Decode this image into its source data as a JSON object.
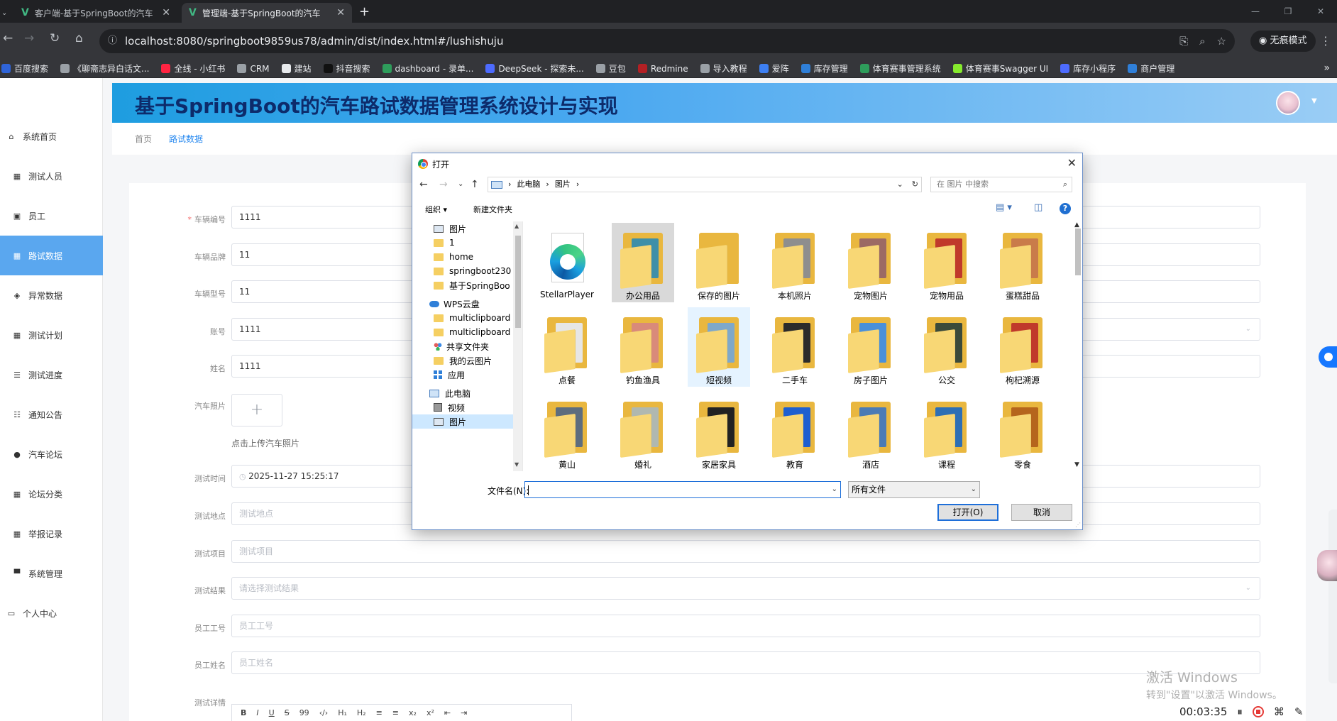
{
  "browser": {
    "tabs": [
      {
        "title": "客户端-基于SpringBoot的汽车"
      },
      {
        "title": "管理端-基于SpringBoot的汽车"
      }
    ],
    "url": "localhost:8080/springboot9859us78/admin/dist/index.html#/lushishuju",
    "incognito_label": "无痕模式",
    "bookmarks": [
      {
        "label": "百度搜索",
        "color": "#2f64d8"
      },
      {
        "label": "《聊斋志异白话文...",
        "color": "#9aa0a6"
      },
      {
        "label": "全线 - 小红书",
        "color": "#ff2442"
      },
      {
        "label": "CRM",
        "color": "#9aa0a6"
      },
      {
        "label": "建站",
        "color": "#e8eaed"
      },
      {
        "label": "抖音搜索",
        "color": "#111111"
      },
      {
        "label": "dashboard - 录单...",
        "color": "#2e9d5b"
      },
      {
        "label": "DeepSeek - 探索未...",
        "color": "#4d6bfe"
      },
      {
        "label": "豆包",
        "color": "#9aa0a6"
      },
      {
        "label": "Redmine",
        "color": "#b32024"
      },
      {
        "label": "导入教程",
        "color": "#9aa0a6"
      },
      {
        "label": "爱阵",
        "color": "#3d7ff2"
      },
      {
        "label": "库存管理",
        "color": "#2f7fd8"
      },
      {
        "label": "体育赛事管理系统",
        "color": "#2e9d5b"
      },
      {
        "label": "体育赛事Swagger UI",
        "color": "#85ea2d"
      },
      {
        "label": "库存小程序",
        "color": "#4d6bfe"
      },
      {
        "label": "商户管理",
        "color": "#2f7fd8"
      }
    ]
  },
  "app": {
    "title": "基于SpringBoot的汽车路试数据管理系统设计与实现",
    "breadcrumb": {
      "home": "首页",
      "current": "路试数据"
    },
    "menu": [
      {
        "label": "系统首页",
        "icon": "home-icon"
      },
      {
        "label": "测试人员",
        "icon": "grid-icon"
      },
      {
        "label": "员工",
        "icon": "user-card-icon"
      },
      {
        "label": "路试数据",
        "icon": "grid-icon"
      },
      {
        "label": "异常数据",
        "icon": "warn-icon"
      },
      {
        "label": "测试计划",
        "icon": "grid-icon"
      },
      {
        "label": "测试进度",
        "icon": "list-icon"
      },
      {
        "label": "通知公告",
        "icon": "sliders-icon"
      },
      {
        "label": "汽车论坛",
        "icon": "person-icon"
      },
      {
        "label": "论坛分类",
        "icon": "grid-icon"
      },
      {
        "label": "举报记录",
        "icon": "grid-icon"
      },
      {
        "label": "系统管理",
        "icon": "monitor-icon"
      },
      {
        "label": "个人中心",
        "icon": "card-icon"
      }
    ],
    "form": {
      "vehicle_no": {
        "label": "车辆编号",
        "value": "1111"
      },
      "brand": {
        "label": "车辆品牌",
        "value": "11"
      },
      "model": {
        "label": "车辆型号",
        "value": "11"
      },
      "account": {
        "label": "账号",
        "value": "1111"
      },
      "name": {
        "label": "姓名",
        "value": "1111"
      },
      "photo": {
        "label": "汽车照片",
        "hint": "点击上传汽车照片"
      },
      "test_time": {
        "label": "测试时间",
        "value": "2025-11-27 15:25:17"
      },
      "test_place": {
        "label": "测试地点",
        "placeholder": "测试地点"
      },
      "test_item": {
        "label": "测试项目",
        "placeholder": "测试项目"
      },
      "test_result": {
        "label": "测试结果",
        "placeholder": "请选择测试结果"
      },
      "emp_no": {
        "label": "员工工号",
        "placeholder": "员工工号"
      },
      "emp_name": {
        "label": "员工姓名",
        "placeholder": "员工姓名"
      },
      "detail": {
        "label": "测试详情"
      }
    },
    "editor_tools": [
      "B",
      "I",
      "U",
      "S",
      "99",
      "‹/›",
      "H₁",
      "H₂",
      "≡",
      "≡",
      "x₂",
      "x²",
      "⇤",
      "⇥"
    ]
  },
  "dialog": {
    "title": "打开",
    "path": [
      "此电脑",
      "图片"
    ],
    "search_placeholder": "在 图片 中搜索",
    "organize": "组织",
    "new_folder": "新建文件夹",
    "nav": [
      {
        "label": "图片",
        "icon": "pictures-icon"
      },
      {
        "label": "1",
        "icon": "folder-icon"
      },
      {
        "label": "home",
        "icon": "folder-icon"
      },
      {
        "label": "springboot230",
        "icon": "folder-icon"
      },
      {
        "label": "基于SpringBoo",
        "icon": "folder-icon"
      },
      {
        "label": "WPS云盘",
        "icon": "cloud-icon"
      },
      {
        "label": "multiclipboard",
        "icon": "folder-icon"
      },
      {
        "label": "multiclipboard",
        "icon": "folder-icon"
      },
      {
        "label": "共享文件夹",
        "icon": "shared-icon"
      },
      {
        "label": "我的云图片",
        "icon": "folder-icon"
      },
      {
        "label": "应用",
        "icon": "apps-icon"
      },
      {
        "label": "此电脑",
        "icon": "pc-icon"
      },
      {
        "label": "视频",
        "icon": "video-icon"
      },
      {
        "label": "图片",
        "icon": "pictures-icon"
      }
    ],
    "files": [
      {
        "name": "StellarPlayer",
        "kind": "app"
      },
      {
        "name": "办公用品",
        "kind": "folder",
        "photo": "#3f8fa8"
      },
      {
        "name": "保存的图片",
        "kind": "folder",
        "photo": ""
      },
      {
        "name": "本机照片",
        "kind": "folder",
        "photo": "#8e8e8e"
      },
      {
        "name": "宠物图片",
        "kind": "folder",
        "photo": "#9c6a64"
      },
      {
        "name": "宠物用品",
        "kind": "folder",
        "photo": "#c0392b"
      },
      {
        "name": "蛋糕甜品",
        "kind": "folder",
        "photo": "#c97b4a"
      },
      {
        "name": "点餐",
        "kind": "folder",
        "photo": "#e6e6e6"
      },
      {
        "name": "钓鱼渔具",
        "kind": "folder",
        "photo": "#d98a7a"
      },
      {
        "name": "短视频",
        "kind": "folder",
        "photo": "#7fa8c9"
      },
      {
        "name": "二手车",
        "kind": "folder",
        "photo": "#2b2b2b"
      },
      {
        "name": "房子图片",
        "kind": "folder",
        "photo": "#4a90d9"
      },
      {
        "name": "公交",
        "kind": "folder",
        "photo": "#3b4a3a"
      },
      {
        "name": "枸杞溯源",
        "kind": "folder",
        "photo": "#c0392b"
      },
      {
        "name": "黄山",
        "kind": "folder",
        "photo": "#5d6d7e"
      },
      {
        "name": "婚礼",
        "kind": "folder",
        "photo": "#b0b8b0"
      },
      {
        "name": "家居家具",
        "kind": "folder",
        "photo": "#222222"
      },
      {
        "name": "教育",
        "kind": "folder",
        "photo": "#1e5fd0"
      },
      {
        "name": "酒店",
        "kind": "folder",
        "photo": "#4b7bb5"
      },
      {
        "name": "课程",
        "kind": "folder",
        "photo": "#2d6fb5"
      },
      {
        "name": "零食",
        "kind": "folder",
        "photo": "#b5651d"
      }
    ],
    "filename_label": "文件名(N):",
    "filename_value": "",
    "filetype": "所有文件",
    "open_button": "打开(O)",
    "cancel_button": "取消"
  },
  "overlay": {
    "activate_line1": "激活 Windows",
    "activate_line2": "转到\"设置\"以激活 Windows。",
    "rec_time": "00:03:35"
  }
}
